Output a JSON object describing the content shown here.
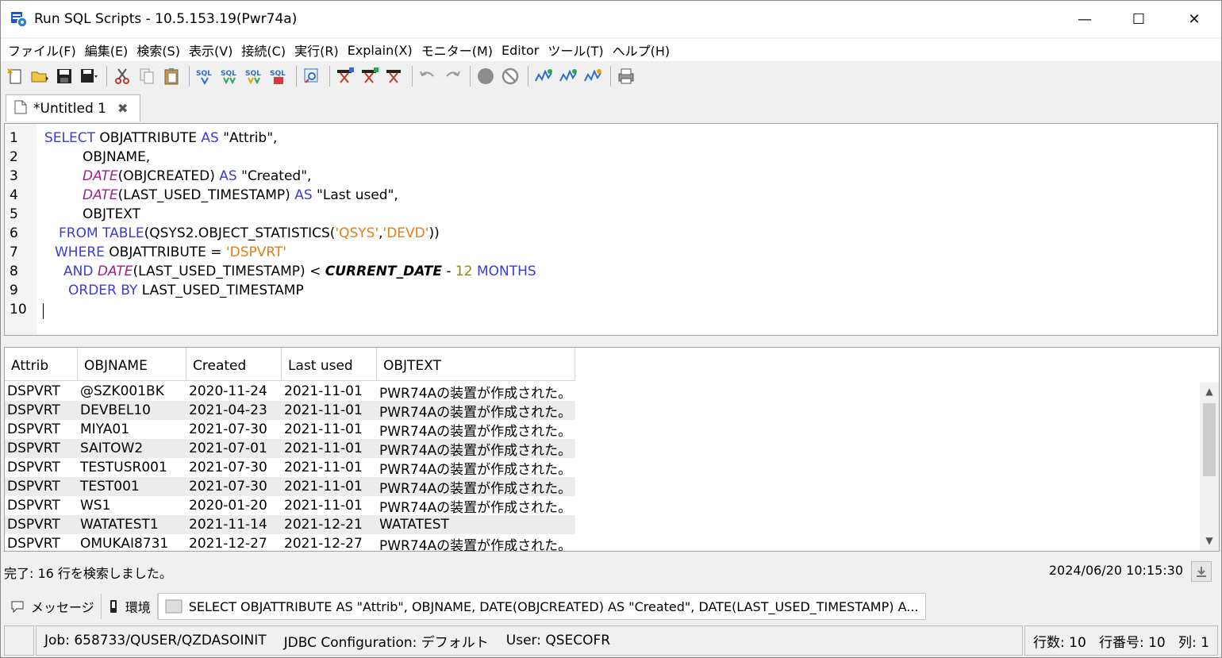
{
  "window": {
    "title": "Run SQL Scripts - 10.5.153.19(Pwr74a)",
    "minimize": "—",
    "maximize": "☐",
    "close": "✕"
  },
  "menu": [
    "ファイル(F)",
    "編集(E)",
    "検索(S)",
    "表示(V)",
    "接続(C)",
    "実行(R)",
    "Explain(X)",
    "モニター(M)",
    "Editor",
    "ツール(T)",
    "ヘルプ(H)"
  ],
  "tab": {
    "label": "*Untitled 1",
    "close": "✖"
  },
  "editor": {
    "line_numbers": [
      "1",
      "2",
      "3",
      "4",
      "5",
      "6",
      "7",
      "8",
      "9",
      "10"
    ],
    "lines": [
      "SELECT OBJATTRIBUTE AS \"Attrib\",",
      "OBJNAME,",
      "DATE(OBJCREATED) AS \"Created\",",
      "DATE(LAST_USED_TIMESTAMP) AS \"Last used\",",
      "OBJTEXT",
      "FROM TABLE(QSYS2.OBJECT_STATISTICS('QSYS','DEVD'))",
      "WHERE OBJATTRIBUTE = 'DSPVRT'",
      "AND DATE(LAST_USED_TIMESTAMP) < CURRENT_DATE - 12 MONTHS",
      "ORDER BY LAST_USED_TIMESTAMP",
      ""
    ]
  },
  "results": {
    "columns": [
      "Attrib",
      "OBJNAME",
      "Created",
      "Last used",
      "OBJTEXT"
    ],
    "rows": [
      [
        "DSPVRT",
        "@SZK001BK",
        "2020-11-24",
        "2021-11-01",
        "PWR74Aの装置が作成された。"
      ],
      [
        "DSPVRT",
        "DEVBEL10",
        "2021-04-23",
        "2021-11-01",
        "PWR74Aの装置が作成された。"
      ],
      [
        "DSPVRT",
        "MIYA01",
        "2021-07-30",
        "2021-11-01",
        "PWR74Aの装置が作成された。"
      ],
      [
        "DSPVRT",
        "SAITOW2",
        "2021-07-01",
        "2021-11-01",
        "PWR74Aの装置が作成された。"
      ],
      [
        "DSPVRT",
        "TESTUSR001",
        "2021-07-30",
        "2021-11-01",
        "PWR74Aの装置が作成された。"
      ],
      [
        "DSPVRT",
        "TEST001",
        "2021-07-30",
        "2021-11-01",
        "PWR74Aの装置が作成された。"
      ],
      [
        "DSPVRT",
        "WS1",
        "2020-01-20",
        "2021-11-01",
        "PWR74Aの装置が作成された。"
      ],
      [
        "DSPVRT",
        "WATATEST1",
        "2021-11-14",
        "2021-12-21",
        "WATATEST"
      ],
      [
        "DSPVRT",
        "OMUKAI8731",
        "2021-12-27",
        "2021-12-27",
        "PWR74Aの装置が作成された。"
      ]
    ]
  },
  "status": {
    "message": "完了: 16 行を検索しました。",
    "timestamp": "2024/06/20 10:15:30"
  },
  "bottom_tabs": {
    "messages": "メッセージ",
    "environment": "環境",
    "query": "SELECT OBJATTRIBUTE AS \"Attrib\", OBJNAME, DATE(OBJCREATED) AS \"Created\", DATE(LAST_USED_TIMESTAMP) A..."
  },
  "jobbar": {
    "job": "Job: 658733/QUSER/QZDASOINIT",
    "jdbc": "JDBC Configuration: デフォルト",
    "user": "User: QSECOFR",
    "position": "行数: 10   行番号: 10   列: 1"
  }
}
